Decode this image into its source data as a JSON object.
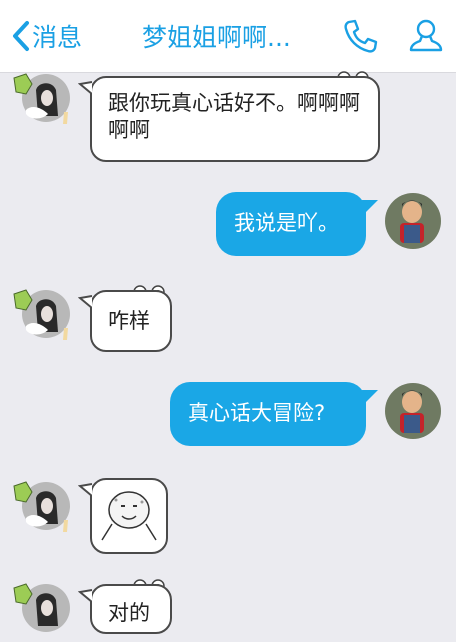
{
  "header": {
    "back_label": "消息",
    "title": "梦姐姐啊啊...",
    "icons": [
      "back-chevron-icon",
      "phone-icon",
      "contact-person-icon"
    ],
    "accent_color": "#1aa0e4"
  },
  "messages": [
    {
      "side": "incoming",
      "text": "跟你玩真心话好不。啊啊啊啊啊"
    },
    {
      "side": "outgoing",
      "text": "我说是吖。"
    },
    {
      "side": "incoming",
      "text": "咋样"
    },
    {
      "side": "outgoing",
      "text": "真心话大冒险?"
    },
    {
      "side": "incoming",
      "type": "sticker",
      "sticker": "meme-face-sticker"
    },
    {
      "side": "incoming",
      "text": "对的"
    }
  ],
  "colors": {
    "outgoing_bubble": "#1aa7e6",
    "incoming_bubble": "#ffffff",
    "background": "#ebebf0"
  }
}
